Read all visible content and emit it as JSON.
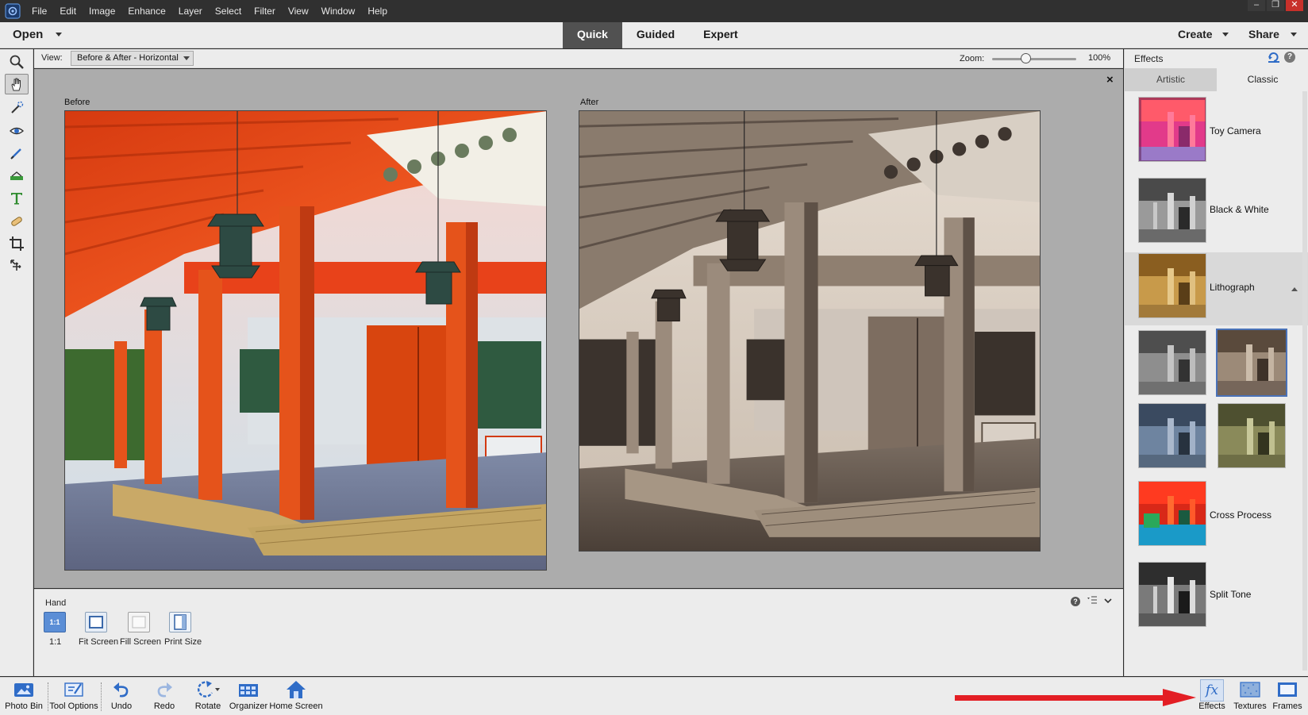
{
  "menubar": {
    "items": [
      "File",
      "Edit",
      "Image",
      "Enhance",
      "Layer",
      "Select",
      "Filter",
      "View",
      "Window",
      "Help"
    ],
    "window_controls": {
      "minimize": "–",
      "restore": "❐",
      "close": "✕"
    }
  },
  "modebar": {
    "open_label": "Open",
    "tabs": [
      {
        "label": "Quick",
        "active": true
      },
      {
        "label": "Guided",
        "active": false
      },
      {
        "label": "Expert",
        "active": false
      }
    ],
    "create_label": "Create",
    "share_label": "Share"
  },
  "optbar": {
    "view_label": "View:",
    "view_value": "Before & After - Horizontal",
    "zoom_label": "Zoom:",
    "zoom_value": "100%",
    "zoom_level": 0.4
  },
  "canvas": {
    "before_label": "Before",
    "after_label": "After",
    "close_glyph": "×"
  },
  "tool_options": {
    "title": "Hand",
    "help_glyph": "?",
    "buttons": [
      {
        "label": "1:1",
        "icon": "one-to-one-icon",
        "badge": "1:1"
      },
      {
        "label": "Fit Screen",
        "icon": "fit-screen-icon"
      },
      {
        "label": "Fill Screen",
        "icon": "fill-screen-icon"
      },
      {
        "label": "Print Size",
        "icon": "print-size-icon"
      }
    ]
  },
  "effects": {
    "title": "Effects",
    "help_glyph": "?",
    "tabs": [
      {
        "label": "Artistic",
        "active": false
      },
      {
        "label": "Classic",
        "active": true
      }
    ],
    "items": [
      {
        "label": "Toy Camera",
        "tone": "toy"
      },
      {
        "label": "Black & White",
        "tone": "bw"
      },
      {
        "label": "Lithograph",
        "tone": "litho",
        "expanded": true
      },
      {
        "label": "Cross Process",
        "tone": "cross"
      },
      {
        "label": "Split Tone",
        "tone": "split"
      }
    ],
    "variations": [
      {
        "tone": "gray"
      },
      {
        "tone": "sepia",
        "selected": true
      },
      {
        "tone": "blue"
      },
      {
        "tone": "green"
      }
    ]
  },
  "taskbar": {
    "items": [
      {
        "label": "Photo Bin",
        "icon": "photo-bin-icon"
      },
      {
        "label": "Tool Options",
        "icon": "tool-options-icon"
      },
      {
        "label": "Undo",
        "icon": "undo-icon"
      },
      {
        "label": "Redo",
        "icon": "redo-icon"
      },
      {
        "label": "Rotate",
        "icon": "rotate-icon"
      },
      {
        "label": "Organizer",
        "icon": "organizer-icon"
      },
      {
        "label": "Home Screen",
        "icon": "home-screen-icon"
      },
      {
        "label": "Effects",
        "icon": "effects-fx-icon"
      },
      {
        "label": "Textures",
        "icon": "textures-icon"
      },
      {
        "label": "Frames",
        "icon": "frames-icon"
      }
    ],
    "fx_glyph": "fx"
  },
  "colors": {
    "accent_blue": "#4a72b8",
    "annotation_arrow": "#e31e24",
    "active_mode_tab": "#515151",
    "canvas_gray": "#acacac"
  }
}
